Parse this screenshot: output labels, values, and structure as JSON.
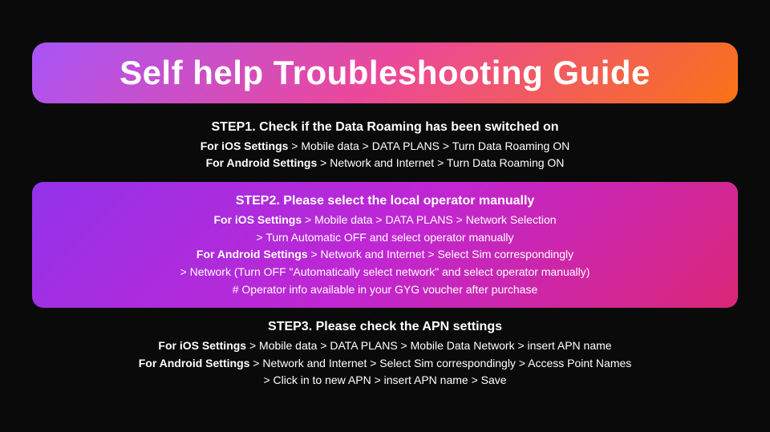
{
  "title": "Self help Troubleshooting Guide",
  "steps": [
    {
      "id": "step1",
      "heading": "STEP1. Check if the Data Roaming has been switched on",
      "highlighted": false,
      "lines": [
        {
          "bold_part": "For iOS Settings",
          "rest": " > Mobile data > DATA PLANS > Turn Data Roaming ON"
        },
        {
          "bold_part": "For Android Settings",
          "rest": " > Network and Internet > Turn Data Roaming ON"
        }
      ]
    },
    {
      "id": "step2",
      "heading": "STEP2. Please select the local operator manually",
      "highlighted": true,
      "lines": [
        {
          "bold_part": "For iOS Settings",
          "rest": " > Mobile data > DATA PLANS > Network Selection"
        },
        {
          "bold_part": "",
          "rest": "> Turn Automatic OFF and select operator manually"
        },
        {
          "bold_part": "For Android Settings",
          "rest": " > Network and Internet > Select Sim correspondingly"
        },
        {
          "bold_part": "",
          "rest": "> Network (Turn OFF \"Automatically select network\" and select operator manually)"
        },
        {
          "bold_part": "",
          "rest": "# Operator info available in your GYG voucher after purchase"
        }
      ]
    },
    {
      "id": "step3",
      "heading": "STEP3. Please check the APN settings",
      "highlighted": false,
      "lines": [
        {
          "bold_part": "For iOS Settings",
          "rest": " > Mobile data > DATA PLANS > Mobile Data Network > insert APN name"
        },
        {
          "bold_part": "For Android Settings",
          "rest": " > Network and Internet > Select Sim correspondingly > Access Point Names"
        },
        {
          "bold_part": "",
          "rest": "> Click in to new APN > insert APN name > Save"
        }
      ]
    }
  ]
}
